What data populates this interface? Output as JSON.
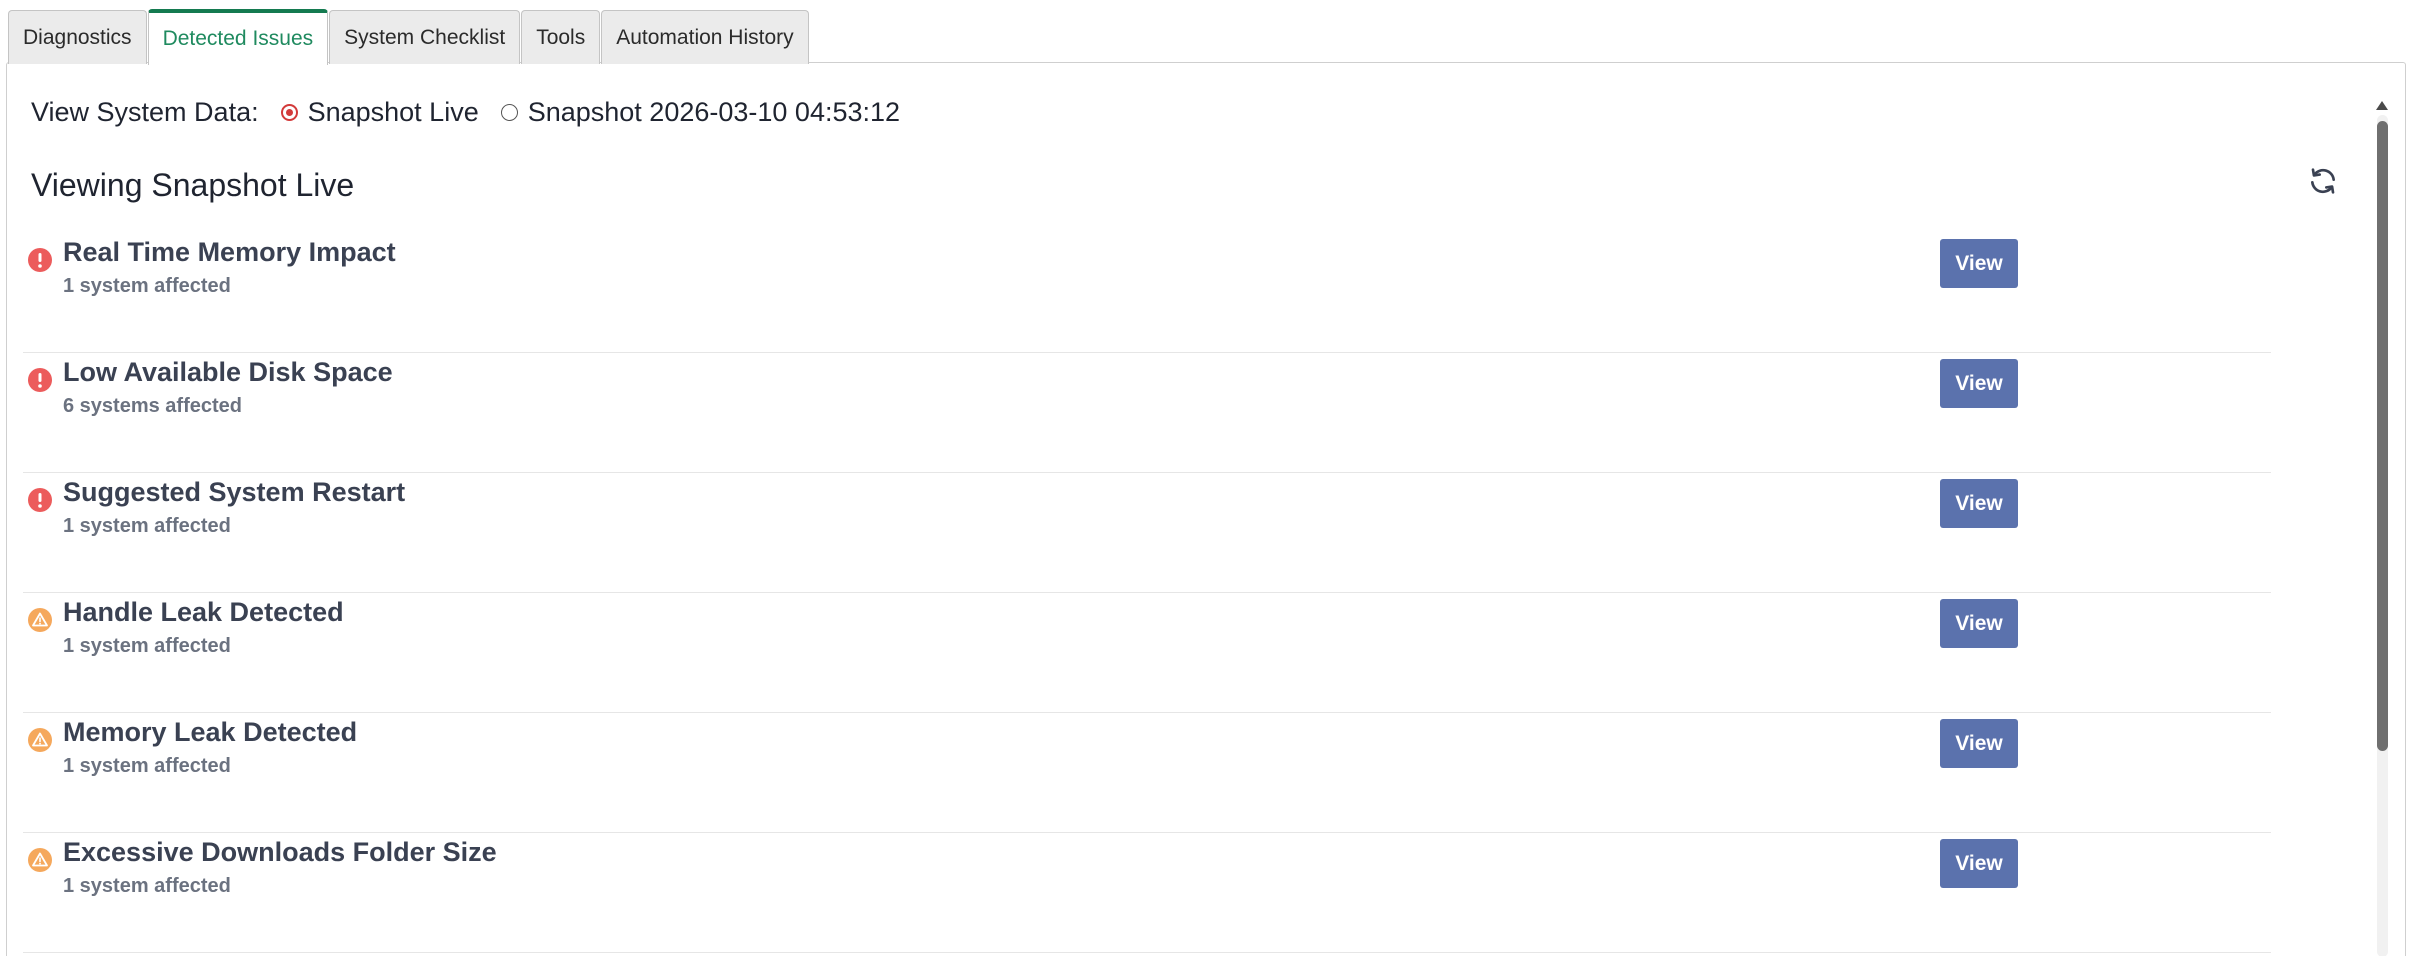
{
  "tabs": [
    {
      "label": "Diagnostics",
      "active": false
    },
    {
      "label": "Detected Issues",
      "active": true
    },
    {
      "label": "System Checklist",
      "active": false
    },
    {
      "label": "Tools",
      "active": false
    },
    {
      "label": "Automation History",
      "active": false
    }
  ],
  "view_data": {
    "label": "View System Data:",
    "options": [
      {
        "label": "Snapshot Live",
        "selected": true
      },
      {
        "label": "Snapshot 2026-03-10 04:53:12",
        "selected": false
      }
    ]
  },
  "viewing_title": "Viewing Snapshot Live",
  "refresh_icon": "refresh-icon",
  "issues": [
    {
      "title": "Real Time Memory Impact",
      "affected": "1 system affected",
      "severity": "error",
      "button": "View"
    },
    {
      "title": "Low Available Disk Space",
      "affected": "6 systems affected",
      "severity": "error",
      "button": "View"
    },
    {
      "title": "Suggested System Restart",
      "affected": "1 system affected",
      "severity": "error",
      "button": "View"
    },
    {
      "title": "Handle Leak Detected",
      "affected": "1 system affected",
      "severity": "warning",
      "button": "View"
    },
    {
      "title": "Memory Leak Detected",
      "affected": "1 system affected",
      "severity": "warning",
      "button": "View"
    },
    {
      "title": "Excessive Downloads Folder Size",
      "affected": "1 system affected",
      "severity": "warning",
      "button": "View"
    }
  ],
  "colors": {
    "active_tab": "#1f8a5f",
    "error": "#ec5c5c",
    "warning": "#f5a85c",
    "button": "#5b72ad",
    "radio_selected": "#d33a3a"
  }
}
